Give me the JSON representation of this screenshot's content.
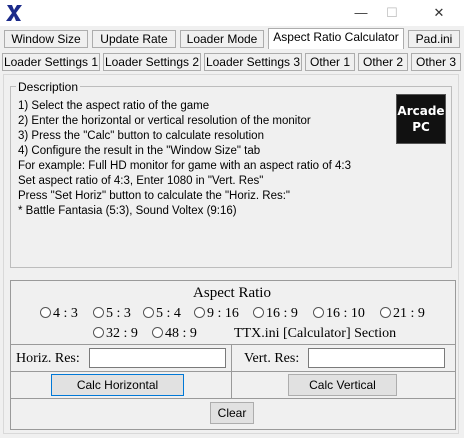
{
  "window": {
    "icon": "app-x-icon",
    "minimize": "—",
    "maximize": "☐",
    "close": "✕"
  },
  "tabs_row1": [
    {
      "label": "Window Size"
    },
    {
      "label": "Update Rate"
    },
    {
      "label": "Loader Mode"
    },
    {
      "label": "Aspect Ratio Calculator",
      "active": true
    },
    {
      "label": "Pad.ini"
    }
  ],
  "tabs_row2": [
    {
      "label": "Loader Settings 1"
    },
    {
      "label": "Loader Settings 2"
    },
    {
      "label": "Loader Settings 3"
    },
    {
      "label": "Other 1"
    },
    {
      "label": "Other 2"
    },
    {
      "label": "Other 3"
    }
  ],
  "description": {
    "legend": "Description",
    "lines": [
      "1) Select the aspect ratio of the game",
      "2) Enter the horizontal or vertical resolution of the monitor",
      "3) Press the \"Calc\" button to calculate resolution",
      "4) Configure the result in the \"Window Size\" tab",
      "For example: Full HD monitor for game with an aspect ratio of 4:3",
      "Set aspect ratio of 4:3, Enter 1080 in \"Vert. Res\"",
      "Press \"Set Horiz\" button to calculate the \"Horiz. Res:\"",
      "* Battle Fantasia (5:3), Sound Voltex (9:16)"
    ],
    "logo_line1": "Arcade",
    "logo_line2": "PC"
  },
  "calculator": {
    "title": "Aspect Ratio",
    "ratios": [
      "4 : 3",
      "5 : 3",
      "5 : 4",
      "9 : 16",
      "16 : 9",
      "16 : 10",
      "21 : 9",
      "32 : 9",
      "48 : 9"
    ],
    "section_label": "TTX.ini [Calculator] Section",
    "horiz_label": "Horiz. Res:",
    "horiz_value": "",
    "vert_label": "Vert. Res:",
    "vert_value": "",
    "calc_horizontal": "Calc Horizontal",
    "calc_vertical": "Calc Vertical",
    "clear": "Clear"
  }
}
